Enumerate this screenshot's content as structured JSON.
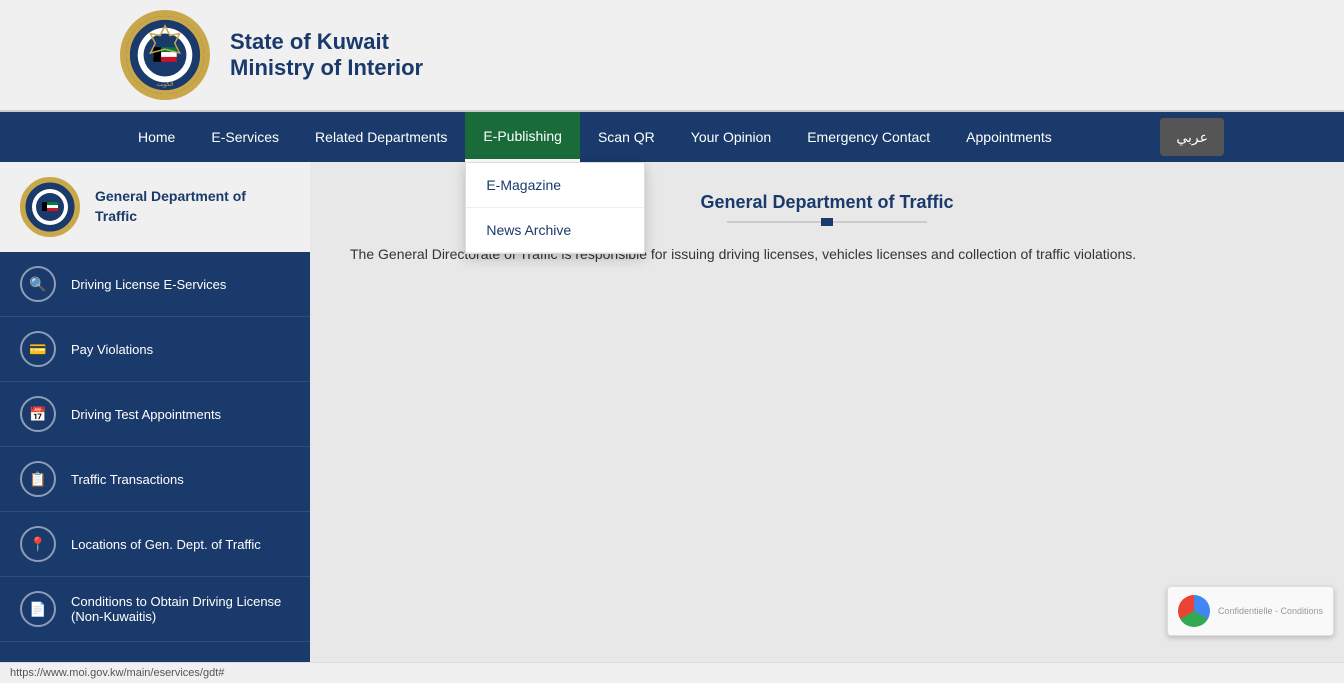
{
  "header": {
    "logo_alt": "Kuwait Police Logo",
    "title_line1": "State of Kuwait",
    "title_line2": "Ministry of Interior"
  },
  "navbar": {
    "items": [
      {
        "id": "home",
        "label": "Home"
      },
      {
        "id": "eservices",
        "label": "E-Services"
      },
      {
        "id": "related-departments",
        "label": "Related Departments"
      },
      {
        "id": "epublishing",
        "label": "E-Publishing",
        "active": true
      },
      {
        "id": "scan-qr",
        "label": "Scan QR"
      },
      {
        "id": "your-opinion",
        "label": "Your Opinion"
      },
      {
        "id": "emergency-contact",
        "label": "Emergency Contact"
      },
      {
        "id": "appointments",
        "label": "Appointments"
      }
    ],
    "arabic_label": "عربي"
  },
  "epublishing_dropdown": {
    "items": [
      {
        "id": "emagazine",
        "label": "E-Magazine"
      },
      {
        "id": "news-archive",
        "label": "News Archive"
      }
    ]
  },
  "sidebar": {
    "dept_name": "General Department of Traffic",
    "menu_items": [
      {
        "id": "driving-license",
        "label": "Driving License E-Services",
        "icon": "🔍"
      },
      {
        "id": "pay-violations",
        "label": "Pay Violations",
        "icon": "💰"
      },
      {
        "id": "driving-test",
        "label": "Driving Test Appointments",
        "icon": "📅"
      },
      {
        "id": "traffic-transactions",
        "label": "Traffic Transactions",
        "icon": "📋"
      },
      {
        "id": "locations",
        "label": "Locations of Gen. Dept. of Traffic",
        "icon": "📍"
      },
      {
        "id": "conditions",
        "label": "Conditions to Obtain Driving License (Non-Kuwaitis)",
        "icon": "📄"
      }
    ]
  },
  "main": {
    "section_title": "General Department of Traffic",
    "description": "The General Directorate of Traffic is responsible for issuing driving licenses, vehicles licenses and collection of traffic violations."
  },
  "status_bar": {
    "url": "https://www.moi.gov.kw/main/eservices/gdt#"
  },
  "recaptcha": {
    "text": "Confidentielle - Conditions"
  }
}
